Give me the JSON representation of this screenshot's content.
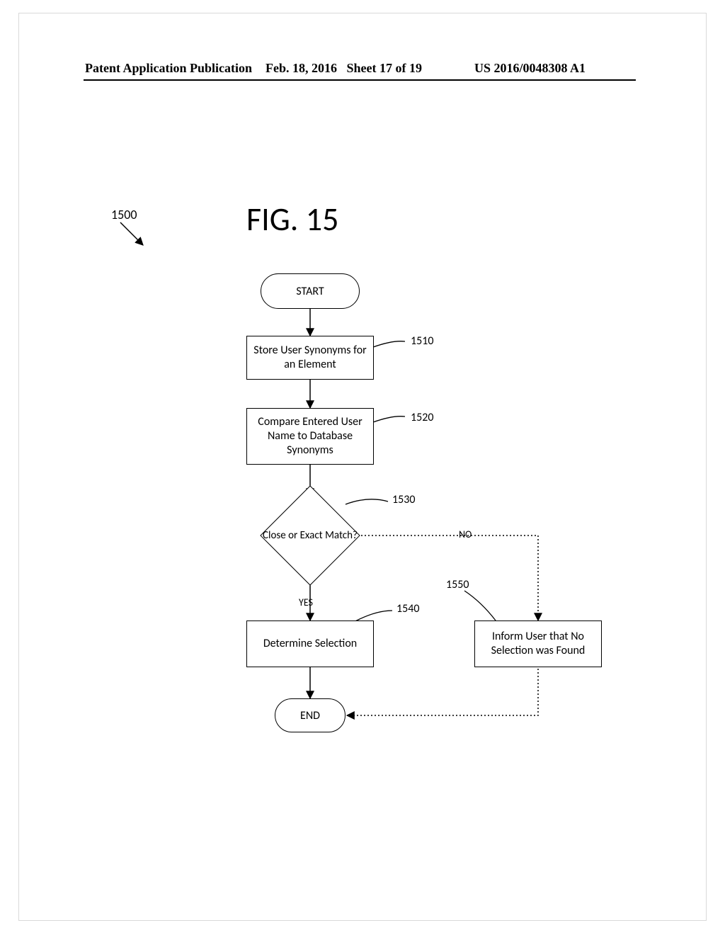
{
  "header": {
    "left": "Patent Application Publication",
    "date": "Feb. 18, 2016",
    "sheet": "Sheet 17 of 19",
    "pubno": "US 2016/0048308 A1"
  },
  "figure": {
    "title": "FIG. 15",
    "id": "1500"
  },
  "nodes": {
    "start": "START",
    "store": "Store User Synonyms for an Element",
    "compare": "Compare Entered User Name to Database Synonyms",
    "decision": "Close or Exact Match?",
    "determine": "Determine Selection",
    "inform": "Inform User that No Selection was Found",
    "end": "END"
  },
  "edges": {
    "yes": "YES",
    "no": "NO"
  },
  "refs": {
    "r1510": "1510",
    "r1520": "1520",
    "r1530": "1530",
    "r1540": "1540",
    "r1550": "1550"
  }
}
